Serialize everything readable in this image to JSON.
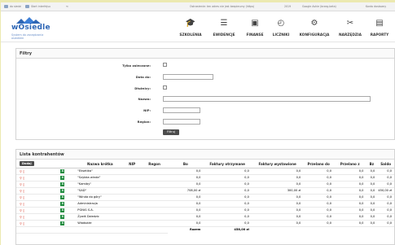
{
  "topbar": {
    "left1": "do siedzi",
    "left2": "Start interfejsu",
    "right1": "Ostrzeżenie: ten adres nie jest bezpieczny (https)",
    "right2": "2019",
    "right3": "Google Ashie (brzeg-beta)",
    "right4": "Konto dostawcy"
  },
  "logo": {
    "brand": "wOsiedle",
    "tagline1": "System do zarządzania",
    "tagline2": "osiedlem"
  },
  "nav": [
    {
      "label": "SZKOLENIA",
      "icon": "graduation-cap-icon",
      "glyph": "🎓"
    },
    {
      "label": "EWIDENCJE",
      "icon": "list-icon",
      "glyph": "☰"
    },
    {
      "label": "FINANSE",
      "icon": "money-icon",
      "glyph": "▣"
    },
    {
      "label": "LICZNIKI",
      "icon": "meter-icon",
      "glyph": "◴"
    },
    {
      "label": "KONFIGURACJA",
      "icon": "gear-icon",
      "glyph": "⚙"
    },
    {
      "label": "NARZĘDZIA",
      "icon": "tools-icon",
      "glyph": "✂"
    },
    {
      "label": "RAPORTY",
      "icon": "report-icon",
      "glyph": "▤"
    }
  ],
  "filters": {
    "title": "Filtry",
    "only_overdue": "Tylko zaleczone:",
    "date_to": "Data do:",
    "debtors": "Dłużnicy:",
    "name": "Nazwa:",
    "nip": "NIP:",
    "region": "Region:",
    "filter_button": "Filtruj"
  },
  "list": {
    "title": "Lista kontrahentów",
    "add_button": "Dodaj",
    "columns": [
      "",
      "",
      "Nazwa krótka",
      "NIP",
      "Regon",
      "Bo",
      "Faktury otrzymane",
      "Faktury wystawione",
      "Przelano do",
      "Przelano z",
      "Bz",
      "Saldo"
    ],
    "rows": [
      {
        "name": "\"Eksetika\"",
        "nip": "",
        "regon": "",
        "bo": "0,0",
        "fo": "0,0",
        "fw": "0,0",
        "pd": "0,0",
        "pz": "0,0",
        "bz": "0,0",
        "saldo": "0,0"
      },
      {
        "name": "\"Szybka winda\"",
        "nip": "",
        "regon": "",
        "bo": "0,0",
        "fo": "0,0",
        "fw": "0,0",
        "pd": "0,0",
        "pz": "0,0",
        "bz": "0,0",
        "saldo": "0,0"
      },
      {
        "name": "\"Kamiby\"",
        "nip": "",
        "regon": "",
        "bo": "0,0",
        "fo": "0,0",
        "fw": "0,0",
        "pd": "0,0",
        "pz": "0,0",
        "bz": "0,0",
        "saldo": "0,0"
      },
      {
        "name": "\"SAD\"",
        "nip": "",
        "regon": "",
        "bo": "708,00 zł",
        "fo": "0,0",
        "fw": "300,00 zł",
        "pd": "0,0",
        "pz": "0,0",
        "bz": "0,0",
        "saldo": "450,00 zł"
      },
      {
        "name": "\"Winda do góry\"",
        "nip": "",
        "regon": "",
        "bo": "0,0",
        "fo": "0,0",
        "fw": "0,0",
        "pd": "0,0",
        "pz": "0,0",
        "bz": "0,0",
        "saldo": "0,0"
      },
      {
        "name": "Administracja",
        "nip": "",
        "regon": "",
        "bo": "0,0",
        "fo": "0,0",
        "fw": "0,0",
        "pd": "0,0",
        "pz": "0,0",
        "bz": "0,0",
        "saldo": "0,0"
      },
      {
        "name": "PGNiG S.A.",
        "nip": "",
        "regon": "",
        "bo": "0,0",
        "fo": "0,0",
        "fw": "0,0",
        "pd": "0,0",
        "pz": "0,0",
        "bz": "0,0",
        "saldo": "0,0"
      },
      {
        "name": "Żywiś Dziedzic",
        "nip": "",
        "regon": "",
        "bo": "0,0",
        "fo": "0,0",
        "fw": "0,0",
        "pd": "0,0",
        "pz": "0,0",
        "bz": "0,0",
        "saldo": "0,0"
      },
      {
        "name": "Wiadożże",
        "nip": "",
        "regon": "",
        "bo": "0,0",
        "fo": "0,0",
        "fw": "0,0",
        "pd": "0,0",
        "pz": "0,0",
        "bz": "0,0",
        "saldo": "0,0"
      }
    ],
    "total_label": "Razem",
    "total_value": "458,00 zł"
  },
  "colors": {
    "brand": "#2e66b5",
    "excel": "#1f8b3e",
    "action": "#d94a3b",
    "button": "#4c4c4c"
  }
}
